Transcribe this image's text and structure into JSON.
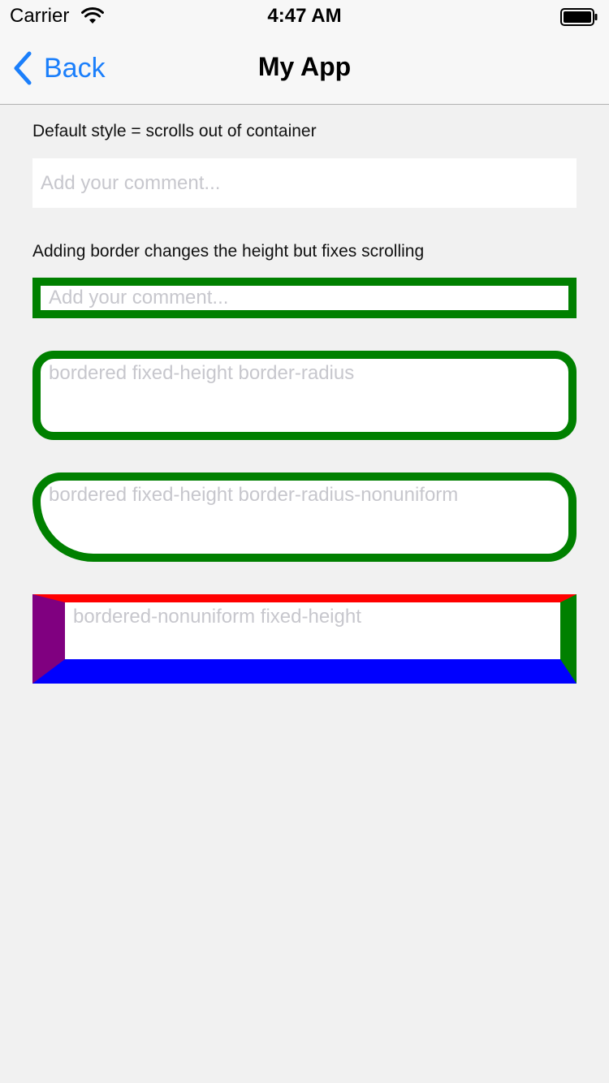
{
  "status_bar": {
    "carrier": "Carrier",
    "time": "4:47 AM"
  },
  "nav": {
    "back_label": "Back",
    "title": "My App"
  },
  "content": {
    "caption_default": "Default style = scrolls out of container",
    "input_default_placeholder": "Add your comment...",
    "caption_border": "Adding border changes the height but fixes scrolling",
    "input_bordered_placeholder": "Add your comment...",
    "input_radius_placeholder": "bordered fixed-height border-radius",
    "input_radius_nonuniform_placeholder": "bordered fixed-height border-radius-nonuniform",
    "input_nonuniform_placeholder": "bordered-nonuniform fixed-height"
  },
  "colors": {
    "background": "#f1f1f1",
    "accent": "#1b7ffb",
    "border_green": "#008000",
    "border_red": "#ff0000",
    "border_blue": "#0000ff",
    "border_purple": "#800080",
    "placeholder": "#c7c7cd"
  },
  "icons": {
    "wifi": "wifi-icon",
    "battery": "battery-icon",
    "back": "chevron-left-icon"
  }
}
